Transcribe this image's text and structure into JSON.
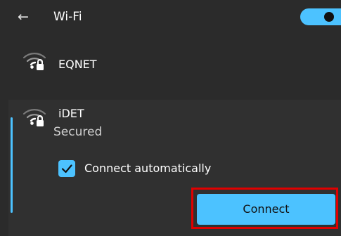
{
  "header": {
    "back_icon": "back-arrow-icon",
    "back_glyph": "←",
    "title": "Wi-Fi",
    "wifi_enabled": true
  },
  "networks": [
    {
      "name": "EQNET",
      "icon": "wifi-secured-icon"
    },
    {
      "name": "iDET",
      "status": "Secured",
      "icon": "wifi-secured-icon",
      "expanded": true
    }
  ],
  "expanded_network": {
    "connect_automatically_label": "Connect automatically",
    "connect_automatically_checked": true,
    "connect_button_label": "Connect"
  },
  "colors": {
    "accent": "#4cc2ff",
    "background": "#2b2b2b",
    "highlight_box": "#e00000"
  }
}
